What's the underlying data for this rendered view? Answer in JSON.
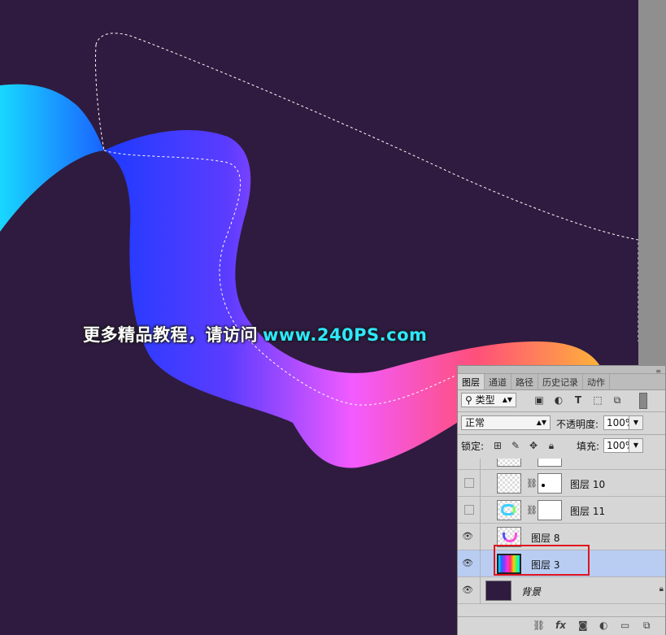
{
  "watermark": {
    "text": "更多精品教程，请访问",
    "url": "www.240PS.com"
  },
  "panel": {
    "tabs": [
      "图层",
      "通道",
      "路径",
      "历史记录",
      "动作"
    ],
    "filter": {
      "label": "类型"
    },
    "blend_mode": "正常",
    "opacity_label": "不透明度:",
    "opacity_value": "100%",
    "lock_label": "锁定:",
    "fill_label": "填充:",
    "fill_value": "100%",
    "layers": [
      {
        "name": "图层 10",
        "visible": false,
        "has_mask": true
      },
      {
        "name": "图层 11",
        "visible": false,
        "has_mask": true
      },
      {
        "name": "图层 8",
        "visible": true,
        "has_mask": false
      },
      {
        "name": "图层 3",
        "visible": true,
        "has_mask": false,
        "selected": true
      },
      {
        "name": "背景",
        "visible": true,
        "has_mask": false,
        "locked": true
      }
    ],
    "footer_icons": [
      "link-icon",
      "fx-icon",
      "mask-icon",
      "adjustment-icon",
      "folder-icon",
      "new-layer-icon"
    ]
  },
  "colors": {
    "canvas_bg": "#2f1b3f",
    "highlight": "#e0141b",
    "watermark_url": "#2ee7ff"
  }
}
